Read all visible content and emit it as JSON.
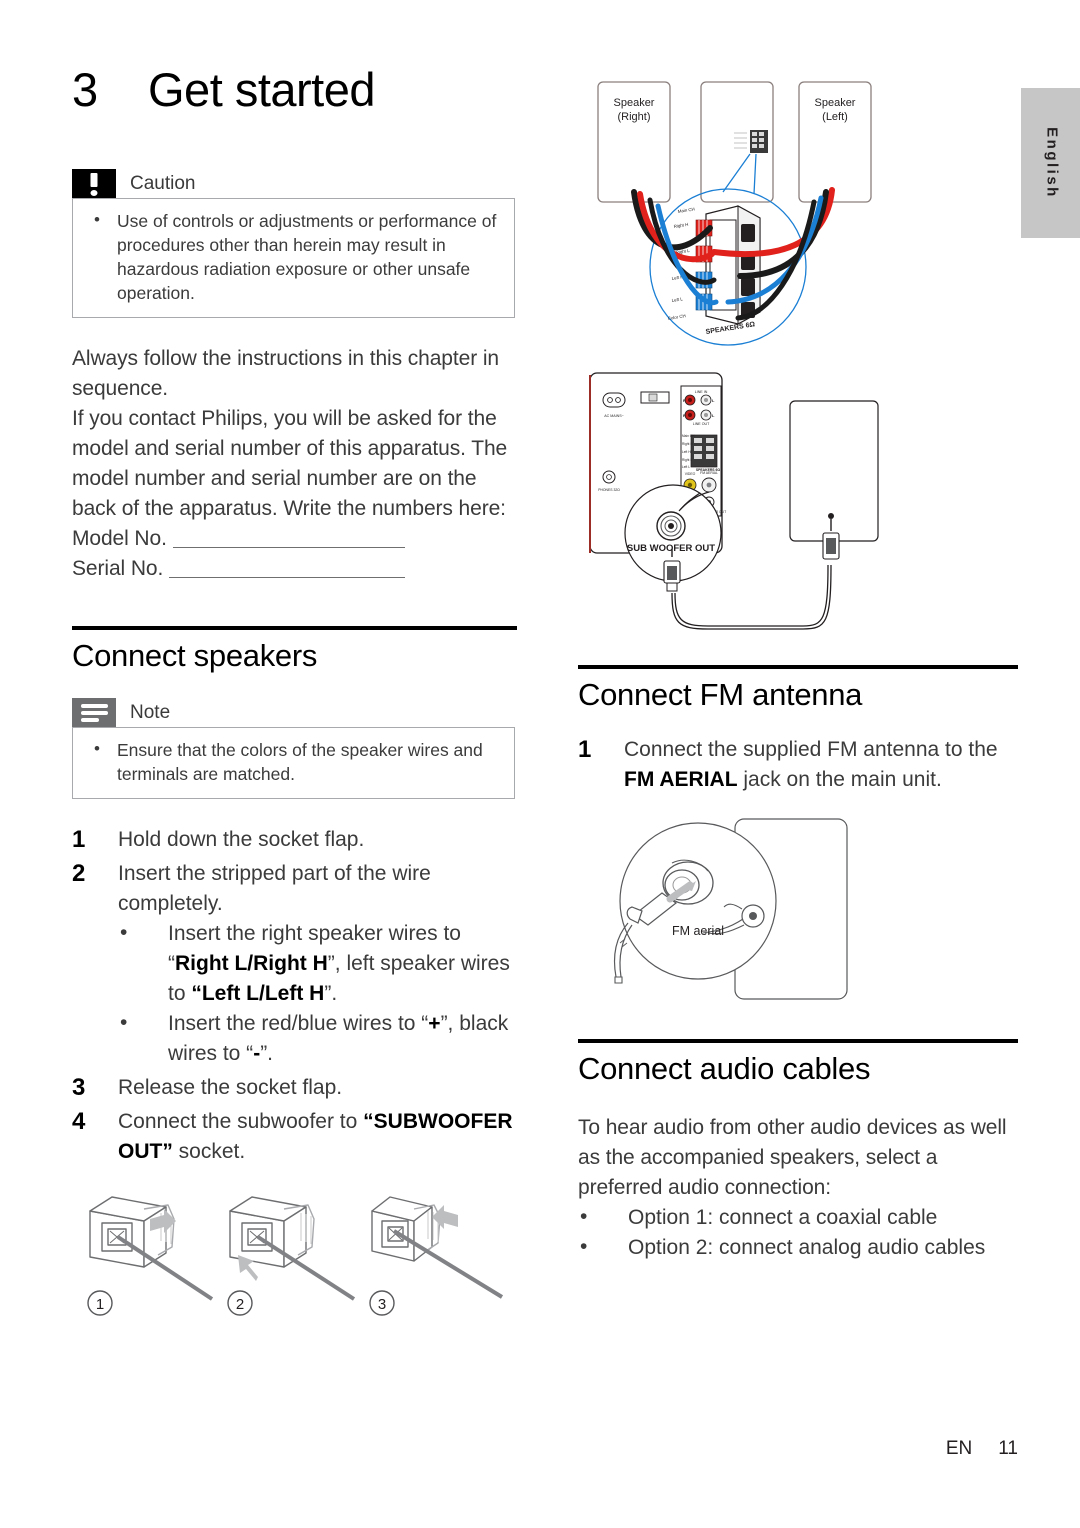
{
  "language_tab": {
    "label": "English"
  },
  "chapter": {
    "number": "3",
    "title": "Get started"
  },
  "caution": {
    "icon": "caution-icon",
    "title": "Caution",
    "items": [
      "Use of controls or adjustments or performance of procedures other than herein may result in hazardous radiation exposure or other unsafe operation."
    ]
  },
  "intro": {
    "paragraph1": "Always follow the instructions in this chapter in sequence.",
    "paragraph2": "If you contact Philips, you will be asked for the model and serial number of this apparatus. The model number and serial number are on the back of the apparatus. Write the numbers here:",
    "model_label": "Model No.",
    "serial_label": "Serial No."
  },
  "connect_speakers": {
    "title": "Connect speakers",
    "note": {
      "icon": "note-icon",
      "title": "Note",
      "items": [
        "Ensure that the colors of the speaker wires and terminals are matched."
      ]
    },
    "steps": [
      {
        "num": "1",
        "text": "Hold down the socket flap."
      },
      {
        "num": "2",
        "text": "Insert the stripped part of the wire completely."
      },
      {
        "num": "3",
        "text": "Release the socket flap."
      },
      {
        "num": "4",
        "text": "Connect the subwoofer to “SUBWOOFER OUT” socket."
      }
    ],
    "step2_sub": [
      {
        "pre": "Insert the right speaker wires to “",
        "bold1": "Right L/Right H",
        "mid": "”, left speaker wires to ",
        "bold2": "“Left L/Left H",
        "post": "”."
      },
      {
        "pre": "Insert the red/blue wires to “",
        "bold1": "+",
        "mid": "”, black wires to “",
        "bold2": "-",
        "post": "”."
      }
    ],
    "step4_prefix": "Connect the subwoofer to",
    "step4_bold": "“SUBWOOFER OUT”",
    "step4_suffix": " socket.",
    "socket_figure": {
      "name": "socket-flap-figure",
      "captions": [
        "1",
        "2",
        "3"
      ]
    }
  },
  "speaker_diagram": {
    "name": "speaker-wiring-diagram",
    "speaker_right": "Speaker\n(Right)",
    "speaker_right_line1": "Speaker",
    "speaker_right_line2": "(Right)",
    "speaker_left_line1": "Speaker",
    "speaker_left_line2": "(Left)",
    "terminal_callout": "SPEAKERS 6Ω",
    "terminal_labels": [
      "Right H",
      "Right L",
      "Left H",
      "Left L"
    ],
    "wire_colors": {
      "positive_red": "#e1211b",
      "negative_black": "#1a1a1a",
      "blue": "#1b7fd4",
      "callout_circle": "#1b7fd4"
    }
  },
  "rear_panel_diagram": {
    "name": "rear-panel-subwoofer-diagram",
    "subwoofer_label": "SUB WOOFER OUT",
    "panel_labels": {
      "line_in": "LINE IN",
      "line_out": "LINE OUT",
      "right": "R",
      "left": "L",
      "ac_mains": "AC MAINS~",
      "speakers": "SPEAKERS 6Ω",
      "video": "VIDEO",
      "fm_aerial": "FM AERIAL",
      "subwoofer_out": "SUBWOOFER OUT"
    }
  },
  "connect_fm_antenna": {
    "title": "Connect FM antenna",
    "steps": [
      {
        "num": "1",
        "pre": "Connect the supplied FM antenna to the ",
        "bold": "FM AERIAL",
        "post": " jack on the main unit."
      }
    ],
    "figure": {
      "name": "fm-aerial-figure",
      "label": "FM aerial"
    }
  },
  "connect_audio_cables": {
    "title": "Connect audio cables",
    "paragraph": "To hear audio from other audio devices as well as the accompanied speakers, select a preferred audio connection:",
    "options": [
      "Option 1: connect a coaxial cable",
      "Option 2: connect analog audio cables"
    ]
  },
  "footer": {
    "language_code": "EN",
    "page_number": "11"
  },
  "colors": {
    "text": "#3b3b3b",
    "heading": "#000000",
    "rule": "#000000",
    "caution_icon_bg": "#000000",
    "note_icon_bg": "#6d6e70",
    "callout_border": "#a7a9ac",
    "tab_bg": "#c6c6c6"
  }
}
